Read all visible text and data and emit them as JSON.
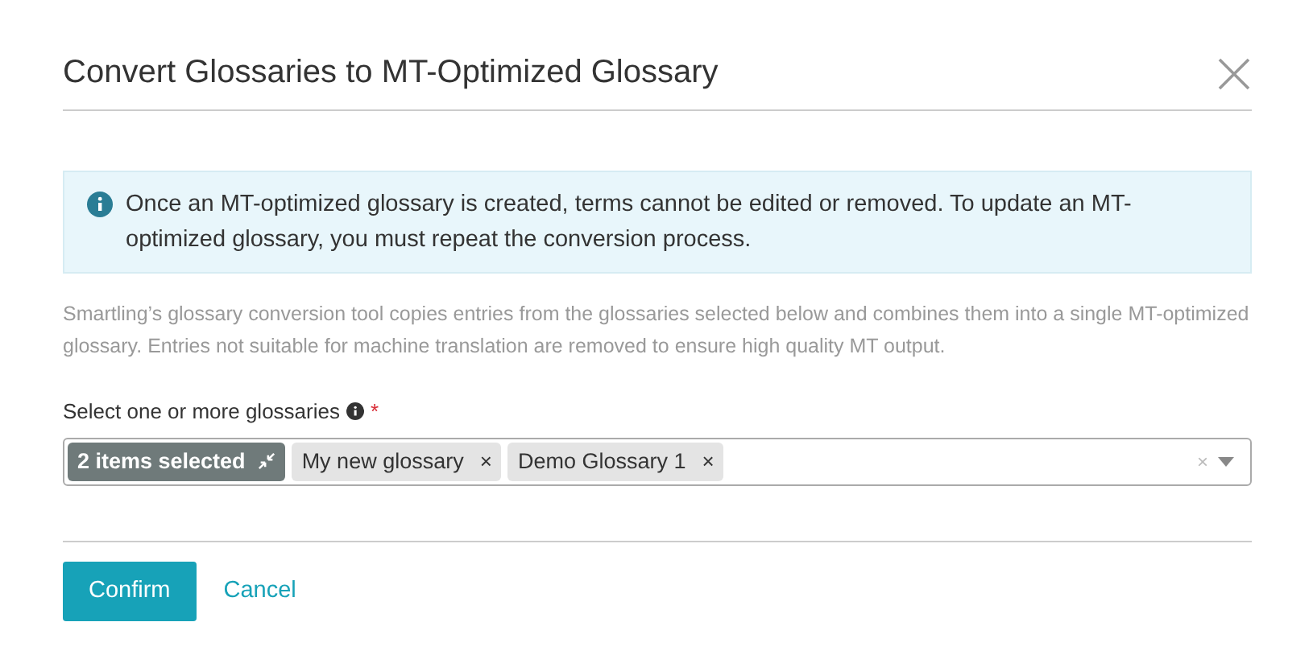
{
  "modal": {
    "title": "Convert Glossaries to MT-Optimized Glossary"
  },
  "alert": {
    "text": "Once an MT-optimized glossary is created, terms cannot be edited or removed. To update an MT-optimized glossary, you must repeat the conversion process."
  },
  "description": "Smartling’s glossary conversion tool copies entries from the glossaries selected below and combines them into a single MT-optimized glossary. Entries not suitable for machine translation are removed to ensure high quality MT output.",
  "field": {
    "label": "Select one or more glossaries",
    "required_mark": "*",
    "tags": [
      {
        "kind": "summary",
        "text": "2 items selected"
      },
      {
        "kind": "item",
        "text": "My new glossary",
        "remove": "×"
      },
      {
        "kind": "item",
        "text": "Demo Glossary 1",
        "remove": "×"
      }
    ],
    "clear": "×"
  },
  "buttons": [
    {
      "kind": "primary",
      "label": "Confirm"
    },
    {
      "kind": "link",
      "label": "Cancel"
    }
  ]
}
